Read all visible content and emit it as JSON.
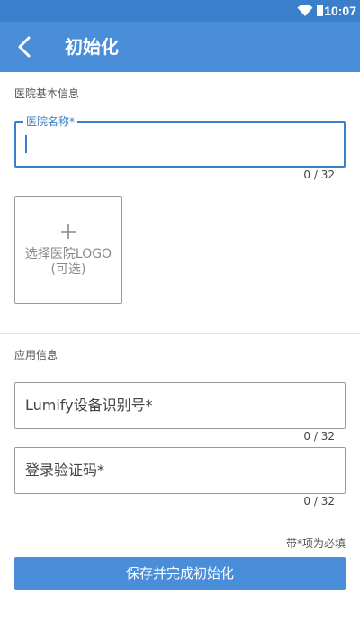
{
  "status_bar": {
    "time": "10:07"
  },
  "app_bar": {
    "title": "初始化"
  },
  "hospital_section": {
    "label": "医院基本信息",
    "name_field": {
      "label": "医院名称*",
      "value": "",
      "counter": "0 / 32"
    },
    "logo_picker": {
      "line1": "选择医院LOGO",
      "line2": "(可选)"
    }
  },
  "app_section": {
    "label": "应用信息",
    "device_id_field": {
      "placeholder": "Lumify设备识别号*",
      "counter": "0 / 32"
    },
    "verify_code_field": {
      "placeholder": "登录验证码*",
      "counter": "0 / 32"
    }
  },
  "required_note": "带*项为必填",
  "submit_button": {
    "label": "保存并完成初始化"
  },
  "colors": {
    "primary": "#4a8dd8",
    "status_bar": "#3a7fcc",
    "focus": "#3a7fcc"
  }
}
